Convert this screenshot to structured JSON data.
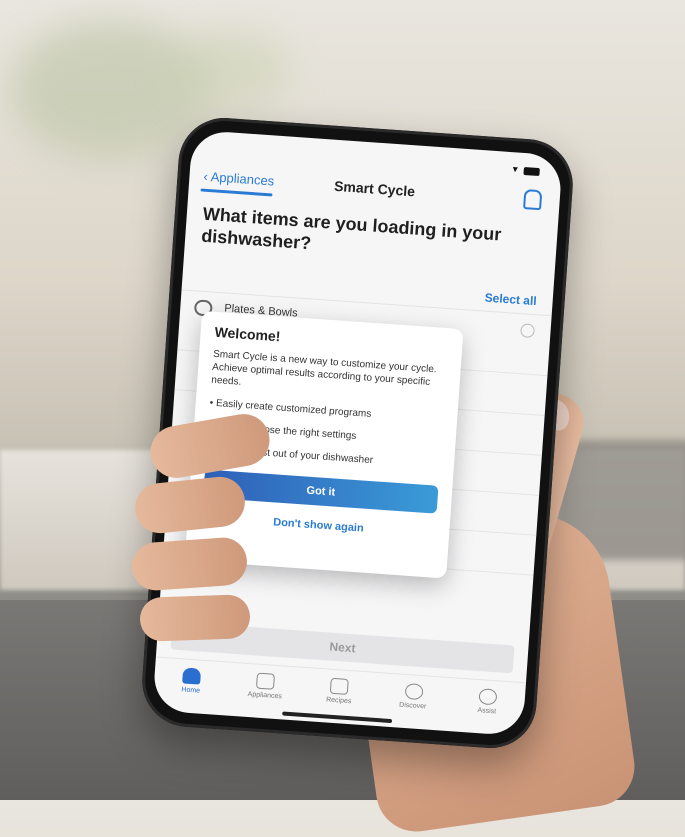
{
  "colors": {
    "accent": "#2a7bd3",
    "button_gradient_start": "#2f5fb8",
    "button_gradient_end": "#3a9bd8"
  },
  "nav": {
    "back_label": "Appliances",
    "title": "Smart Cycle"
  },
  "question": "What items are you loading in your dishwasher?",
  "select_all": "Select all",
  "list": [
    {
      "label": "Plates & Bowls",
      "icon": "plate-icon"
    }
  ],
  "modal": {
    "title": "Welcome!",
    "body": "Smart Cycle is a new way to customize your cycle. Achieve optimal results according to your specific needs.",
    "bullets": [
      "Easily create customized programs",
      "Always choose the right settings",
      "Get the most out of your dishwasher"
    ],
    "primary_label": "Got it",
    "secondary_label": "Don't show again"
  },
  "next_label": "Next",
  "tabs": [
    {
      "label": "Home",
      "icon": "home-icon"
    },
    {
      "label": "Appliances",
      "icon": "appliance-icon"
    },
    {
      "label": "Recipes",
      "icon": "chef-hat-icon"
    },
    {
      "label": "Discover",
      "icon": "compass-icon"
    },
    {
      "label": "Assist",
      "icon": "smile-icon"
    }
  ]
}
